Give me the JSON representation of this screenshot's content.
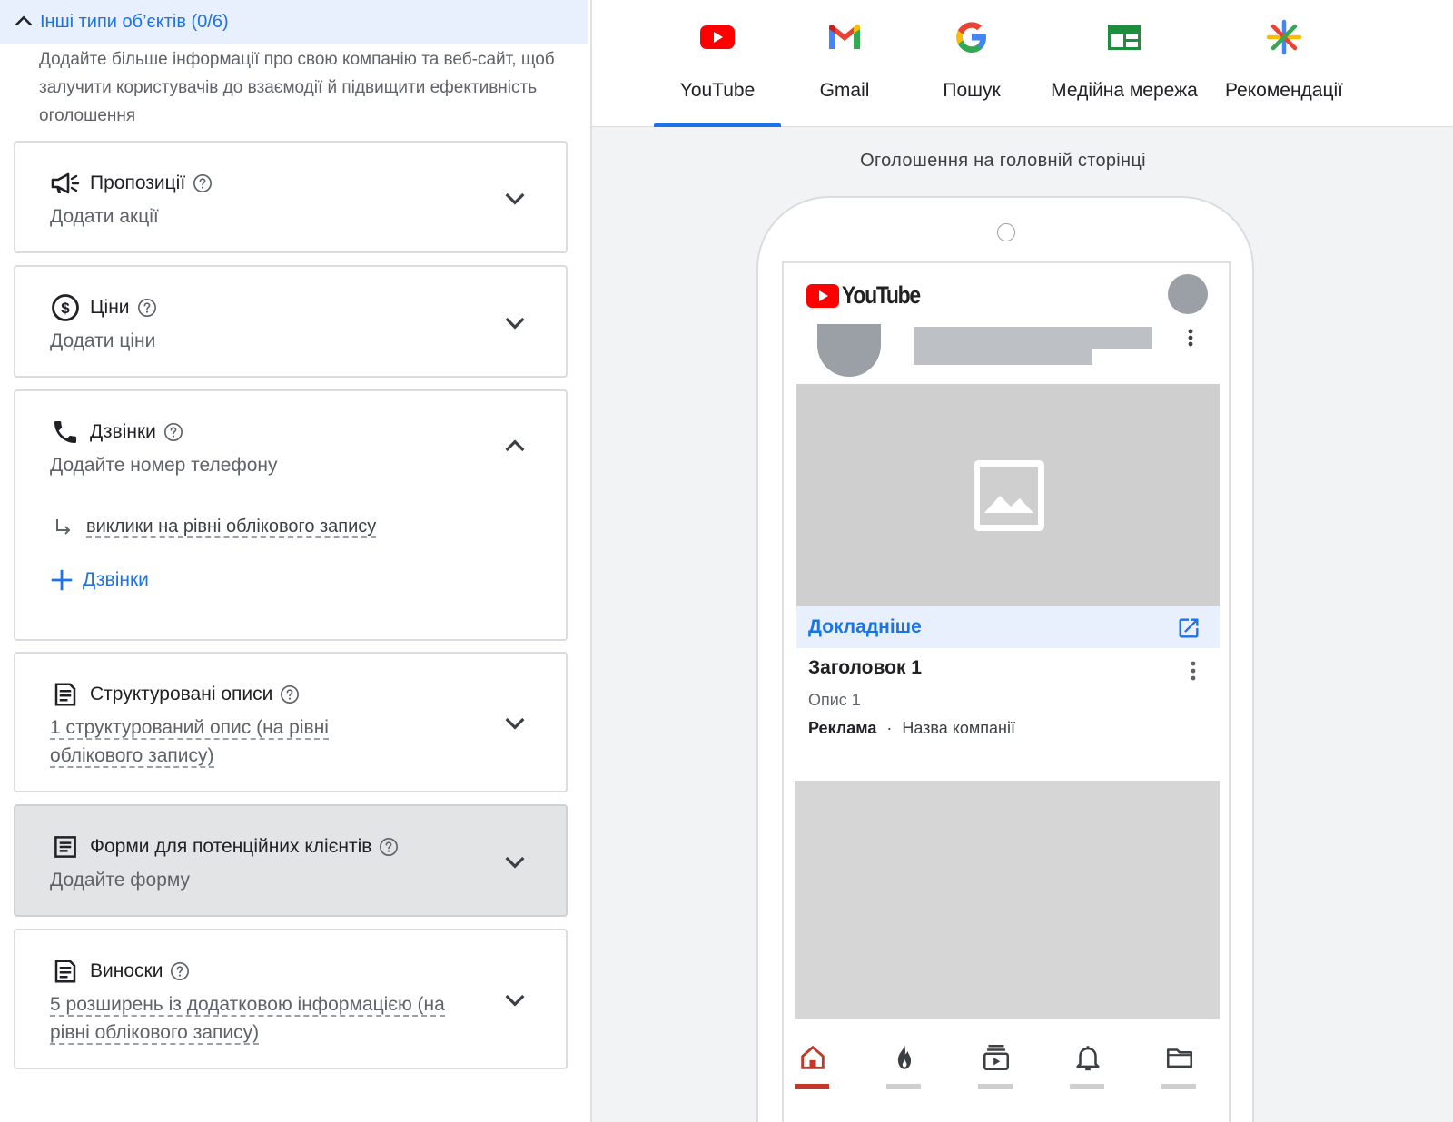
{
  "section": {
    "title": "Інші типи об’єктів (0/6)",
    "description": "Додайте більше інформації про свою компанію та веб-сайт, щоб залучити користувачів до взаємодії й підвищити ефективність оголошення"
  },
  "cards": {
    "promotions": {
      "title": "Пропозиції",
      "subtitle": "Додати акції",
      "icon": "megaphone-icon"
    },
    "prices": {
      "title": "Ціни",
      "subtitle": "Додати ціни",
      "icon": "dollar-circle-icon"
    },
    "calls": {
      "title": "Дзвінки",
      "subtitle": "Додайте номер телефону",
      "icon": "phone-icon",
      "account_link": "виклики на рівні облікового запису",
      "add_label": "Дзвінки"
    },
    "snippets": {
      "title": "Структуровані описи",
      "subtitle": "1 структурований опис (на рівні облікового запису)",
      "icon": "document-icon"
    },
    "lead_forms": {
      "title": "Форми для потенційних клієнтів",
      "subtitle": "Додайте форму",
      "icon": "form-icon"
    },
    "callouts": {
      "title": "Виноски",
      "subtitle": "5 розширень із додатковою інформацією (на рівні облікового запису)",
      "icon": "document-icon"
    }
  },
  "tabs": [
    {
      "label": "YouTube",
      "icon": "youtube-icon",
      "active": true
    },
    {
      "label": "Gmail",
      "icon": "gmail-icon",
      "active": false
    },
    {
      "label": "Пошук",
      "icon": "google-icon",
      "active": false
    },
    {
      "label": "Медійна мережа",
      "icon": "display-network-icon",
      "active": false
    },
    {
      "label": "Рекомендації",
      "icon": "discover-icon",
      "active": false
    }
  ],
  "preview": {
    "caption": "Оголошення на головній сторінці",
    "logo_text": "YouTube",
    "cta": "Докладніше",
    "ad_title": "Заголовок 1",
    "ad_description": "Опис 1",
    "ad_badge": "Реклама",
    "separator": "·",
    "company": "Назва компанії"
  },
  "colors": {
    "accent": "#1a73e8",
    "header_bg": "#e8f0fe",
    "youtube_red": "#ff0000",
    "active_nav": "#c0392b"
  }
}
